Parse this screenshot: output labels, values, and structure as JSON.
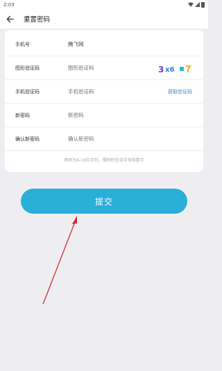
{
  "status_bar": {
    "time": "2:03"
  },
  "header": {
    "title": "重置密码"
  },
  "form": {
    "rows": [
      {
        "label": "手机号",
        "value": "腾飞网"
      },
      {
        "label": "图形验证码",
        "placeholder": "图形验证码",
        "captcha_text": "3 x6 ¤"
      },
      {
        "label": "手机验证码",
        "placeholder": "手机验证码",
        "action": "获取验证码"
      },
      {
        "label": "新密码",
        "placeholder": "新密码"
      },
      {
        "label": "确认新密码",
        "placeholder": "确认新密码"
      }
    ],
    "hint": "密码为8-16位字符，需同时包含字母和数字"
  },
  "submit": {
    "label": "提交"
  },
  "colors": {
    "accent": "#2aafd8",
    "link": "#2a8ccc",
    "annotation": "#d42a2a"
  }
}
